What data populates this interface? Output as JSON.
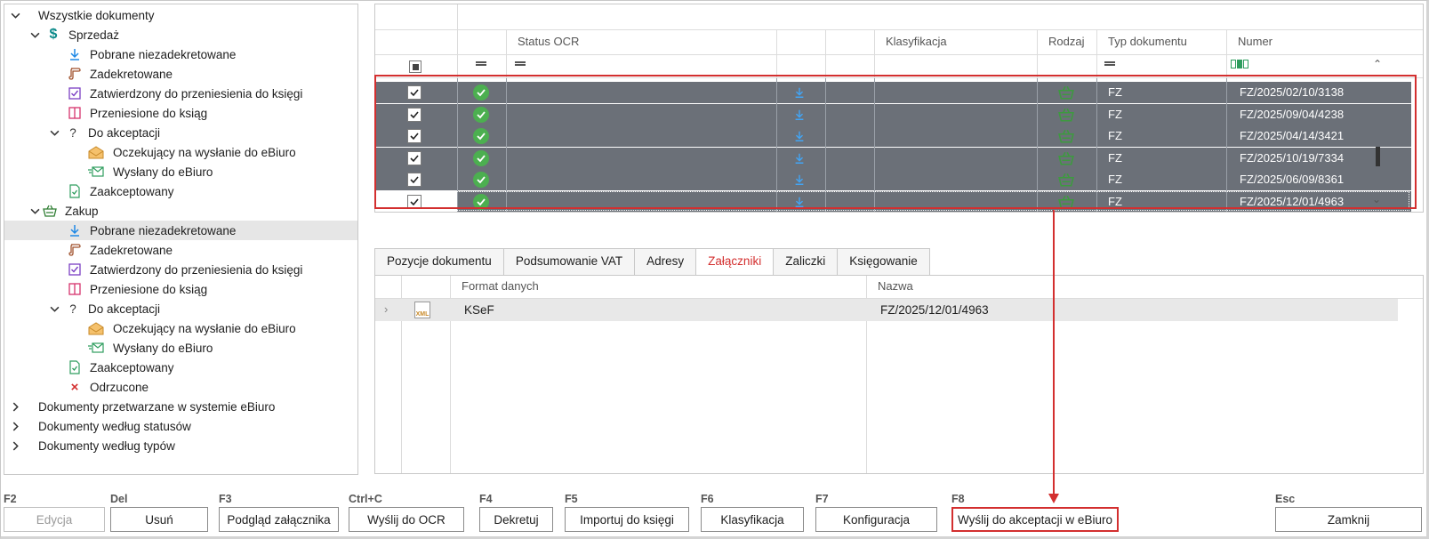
{
  "tree": {
    "root": "Wszystkie dokumenty",
    "sales": {
      "label": "Sprzedaż",
      "items": [
        "Pobrane niezadekretowane",
        "Zadekretowane",
        "Zatwierdzony do przeniesienia do księgi",
        "Przeniesione do ksiąg"
      ],
      "acceptance": {
        "label": "Do akceptacji",
        "items": [
          "Oczekujący na wysłanie do eBiuro",
          "Wysłany do eBiuro"
        ]
      },
      "accepted": "Zaakceptowany"
    },
    "purchase": {
      "label": "Zakup",
      "items": [
        "Pobrane niezadekretowane",
        "Zadekretowane",
        "Zatwierdzony do przeniesienia do księgi",
        "Przeniesione do ksiąg"
      ],
      "acceptance": {
        "label": "Do akceptacji",
        "items": [
          "Oczekujący na wysłanie do eBiuro",
          "Wysłany do eBiuro"
        ]
      },
      "accepted": "Zaakceptowany",
      "rejected": "Odrzucone"
    },
    "bottom": [
      "Dokumenty przetwarzane w systemie eBiuro",
      "Dokumenty według statusów",
      "Dokumenty według typów"
    ]
  },
  "grid": {
    "headers": {
      "ocr": "Status OCR",
      "class": "Klasyfikacja",
      "kind": "Rodzaj",
      "doctype": "Typ dokumentu",
      "number": "Numer"
    },
    "rows": [
      {
        "doctype": "FZ",
        "number": "FZ/2025/02/10/3138"
      },
      {
        "doctype": "FZ",
        "number": "FZ/2025/09/04/4238"
      },
      {
        "doctype": "FZ",
        "number": "FZ/2025/04/14/3421"
      },
      {
        "doctype": "FZ",
        "number": "FZ/2025/10/19/7334"
      },
      {
        "doctype": "FZ",
        "number": "FZ/2025/06/09/8361"
      },
      {
        "doctype": "FZ",
        "number": "FZ/2025/12/01/4963"
      }
    ]
  },
  "tabs": [
    "Pozycje dokumentu",
    "Podsumowanie VAT",
    "Adresy",
    "Załączniki",
    "Zaliczki",
    "Księgowanie"
  ],
  "attachments": {
    "headers": {
      "format": "Format danych",
      "name": "Nazwa"
    },
    "row": {
      "format": "KSeF",
      "name": "FZ/2025/12/01/4963",
      "icon": "XML"
    }
  },
  "buttons": [
    {
      "key": "F2",
      "label": "Edycja"
    },
    {
      "key": "Del",
      "label": "Usuń"
    },
    {
      "key": "F3",
      "label": "Podgląd załącznika"
    },
    {
      "key": "Ctrl+C",
      "label": "Wyślij do OCR"
    },
    {
      "key": "F4",
      "label": "Dekretuj"
    },
    {
      "key": "F5",
      "label": "Importuj do księgi"
    },
    {
      "key": "F6",
      "label": "Klasyfikacja"
    },
    {
      "key": "F7",
      "label": "Konfiguracja"
    },
    {
      "key": "F8",
      "label": "Wyślij do akceptacji w eBiuro"
    },
    {
      "key": "Esc",
      "label": "Zamknij"
    }
  ],
  "colors": {
    "accent": "#d32f2f",
    "selectedRow": "#6b7078",
    "ok": "#4caf50",
    "download": "#1e88e5",
    "basket": "#2e7d32"
  }
}
